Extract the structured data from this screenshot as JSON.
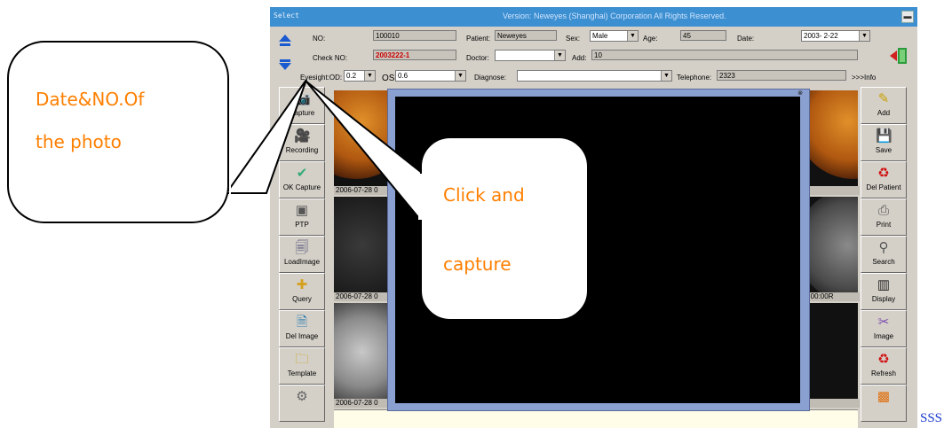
{
  "window": {
    "select_label": "Select",
    "version_text": "Version: Neweyes (Shanghai) Corporation All Rights Reserved.",
    "minimize_glyph": "▬"
  },
  "patient_form": {
    "no_label": "NO:",
    "no_value": "100010",
    "check_no_label": "Check NO:",
    "check_no_value": "2003222-1",
    "patient_label": "Patient:",
    "patient_value": "Neweyes",
    "sex_label": "Sex:",
    "sex_value": "Male",
    "age_label": "Age:",
    "age_value": "45",
    "date_label": "Date:",
    "date_value": "2003- 2-22",
    "doctor_label": "Doctor:",
    "doctor_value": "",
    "add_label": "Add:",
    "add_value": "10",
    "eyesight_od_label": "Eyesight:OD:",
    "eyesight_od_value": "0.2",
    "os_label": "OS",
    "os_value": "0.6",
    "diagnose_label": "Diagnose:",
    "diagnose_value": "",
    "telephone_label": "Telephone:",
    "telephone_value": "2323",
    "info_link": ">>>Info"
  },
  "left_toolbar": [
    {
      "label": "Capture",
      "icon": "camera-icon",
      "glyph": "📷",
      "color": "#444"
    },
    {
      "label": "Recording",
      "icon": "video-camera-icon",
      "glyph": "🎥",
      "color": "#333"
    },
    {
      "label": "OK Capture",
      "icon": "ok-capture-icon",
      "glyph": "✔",
      "color": "#3a7"
    },
    {
      "label": "PTP",
      "icon": "ptp-icon",
      "glyph": "▣",
      "color": "#555"
    },
    {
      "label": "LoadImage",
      "icon": "load-image-icon",
      "glyph": "🗐",
      "color": "#557"
    },
    {
      "label": "Query",
      "icon": "query-icon",
      "glyph": "✚",
      "color": "#d6a020"
    },
    {
      "label": "Del Image",
      "icon": "delete-image-icon",
      "glyph": "🗎",
      "color": "#2a7ab0"
    },
    {
      "label": "Template",
      "icon": "template-icon",
      "glyph": "🗀",
      "color": "#c9a000"
    },
    {
      "label": "",
      "icon": "tool-icon",
      "glyph": "⚙",
      "color": "#666"
    }
  ],
  "right_toolbar": [
    {
      "label": "Add",
      "icon": "add-icon",
      "glyph": "✎",
      "color": "#c9a000"
    },
    {
      "label": "Save",
      "icon": "save-icon",
      "glyph": "💾",
      "color": "#2a5ab0"
    },
    {
      "label": "Del Patient",
      "icon": "delete-patient-icon",
      "glyph": "♻",
      "color": "#d01010"
    },
    {
      "label": "Print",
      "icon": "print-icon",
      "glyph": "⎙",
      "color": "#555"
    },
    {
      "label": "Search",
      "icon": "search-icon",
      "glyph": "⚲",
      "color": "#555"
    },
    {
      "label": "Display",
      "icon": "display-icon",
      "glyph": "▥",
      "color": "#222"
    },
    {
      "label": "Image",
      "icon": "image-icon",
      "glyph": "✂",
      "color": "#7a4ab0"
    },
    {
      "label": "Refresh",
      "icon": "refresh-icon",
      "glyph": "♻",
      "color": "#d01010"
    },
    {
      "label": "",
      "icon": "photo-icon",
      "glyph": "▩",
      "color": "#e07010"
    }
  ],
  "thumbnails": {
    "row1_date": "2006-07-28 0",
    "row2_date": "2006-07-28 0",
    "row3_date": "2006-07-28 0",
    "right_time": "0:00:00R"
  },
  "callouts": {
    "date_no_line1": "Date&NO.Of",
    "date_no_line2": "the    photo",
    "click_line1": "Click    and",
    "click_line2": "capture"
  },
  "corner_text": "SSS"
}
